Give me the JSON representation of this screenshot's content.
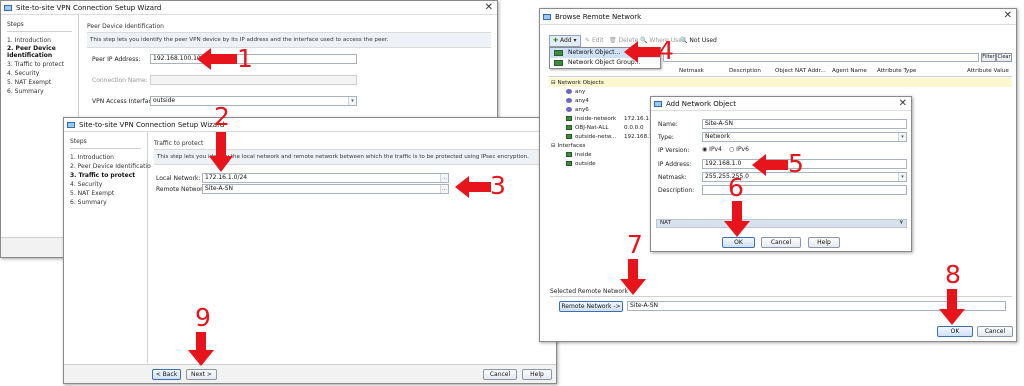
{
  "wizard1": {
    "title": "Site-to-site VPN Connection Setup Wizard",
    "steps_header": "Steps",
    "steps": [
      "1.  Introduction",
      "2.  Peer Device Identification",
      "3.  Traffic to protect",
      "4.  Security",
      "5.  NAT Exempt",
      "6.  Summary"
    ],
    "panel_title": "Peer Device Identification",
    "description": "This step lets you identify the peer VPN device by its IP address and the interface used to access the peer.",
    "peer_ip_label": "Peer IP Address:",
    "peer_ip_value": "192.168.100.100",
    "connection_name_label": "Connection Name:",
    "vpn_interface_label": "VPN Access Interface:",
    "vpn_interface_value": "outside"
  },
  "wizard2": {
    "title": "Site-to-site VPN Connection Setup Wizard",
    "steps_header": "Steps",
    "steps": [
      "1.  Introduction",
      "2.  Peer Device Identificatio",
      "3.  Traffic to protect",
      "4.  Security",
      "5.  NAT Exempt",
      "6.  Summary"
    ],
    "panel_title": "Traffic to protect",
    "description": "This step lets you identify the local network and remote network between which the traffic is to be protected using IPsec encryption.",
    "local_network_label": "Local Network:",
    "local_network_value": "172.16.1.0/24",
    "remote_network_label": "Remote Network:",
    "remote_network_value": "Site-A-SN",
    "back": "< Back",
    "next": "Next >",
    "cancel": "Cancel",
    "help": "Help"
  },
  "browse": {
    "title": "Browse Remote Network",
    "toolbar": {
      "add": "Add",
      "edit": "Edit",
      "delete": "Delete",
      "where_used": "Where Used",
      "not_used": "Not Used"
    },
    "add_menu": [
      "Network Object...",
      "Network Object Group..."
    ],
    "filter": "Filter",
    "clear": "Clear",
    "columns": [
      "Netmask",
      "Description",
      "Object NAT Addr...",
      "Agent Name",
      "Attribute Type",
      "Attribute Value"
    ],
    "groups": {
      "network_objects": "Network Objects",
      "interfaces": "Interfaces"
    },
    "objects": [
      {
        "name": "any",
        "value": ""
      },
      {
        "name": "any4",
        "value": ""
      },
      {
        "name": "any6",
        "value": ""
      },
      {
        "name": "inside-network",
        "value": "172.16.1"
      },
      {
        "name": "OBJ-Nat-ALL",
        "value": "0.0.0.0"
      },
      {
        "name": "outside-netw...",
        "value": "192.168.1"
      }
    ],
    "interfaces": [
      "inside",
      "outside"
    ],
    "selected_section": "Selected Remote Network",
    "remote_network_button": "Remote Network ->",
    "remote_network_value": "Site-A-SN",
    "ok": "OK",
    "cancel": "Cancel"
  },
  "add_object": {
    "title": "Add Network Object",
    "name_label": "Name:",
    "name_value": "Site-A-SN",
    "type_label": "Type:",
    "type_value": "Network",
    "ip_version_label": "IP Version:",
    "ipv4": "IPv4",
    "ipv6": "IPv6",
    "ip_label": "IP Address:",
    "ip_value": "192.168.1.0",
    "netmask_label": "Netmask:",
    "netmask_value": "255.255.255.0",
    "description_label": "Description:",
    "nat_label": "NAT",
    "ok": "OK",
    "cancel": "Cancel",
    "help": "Help"
  },
  "annotations": [
    "1",
    "2",
    "3",
    "4",
    "5",
    "6",
    "7",
    "8",
    "9"
  ],
  "colors": {
    "annotation_red": "#e8141b",
    "selection_blue": "#cfe1f7",
    "accent_blue": "#3d6fb5"
  }
}
